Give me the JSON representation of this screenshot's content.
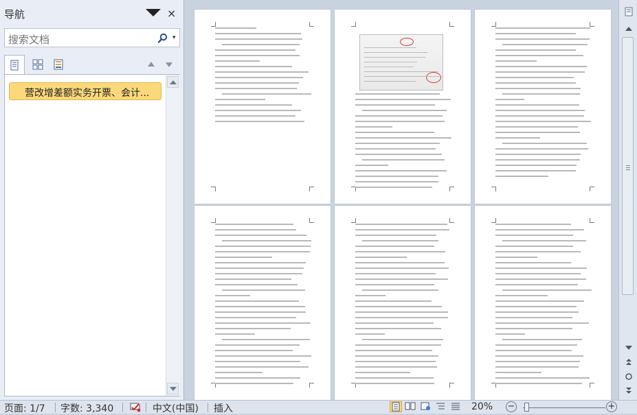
{
  "nav_pane": {
    "title": "导航",
    "close_glyph": "×",
    "search_placeholder": "搜索文档",
    "search_dropdown_glyph": "▾",
    "tabs": [
      "headings",
      "pages",
      "results"
    ],
    "headings": [
      "营改增差额实务开票、会计..."
    ]
  },
  "document": {
    "page_count_rendered": 6,
    "zoom": "20%"
  },
  "status_bar": {
    "page": "页面: 1/7",
    "words": "字数: 3,340",
    "language": "中文(中国)",
    "mode": "插入",
    "zoom": "20%",
    "zoom_minus": "−",
    "zoom_plus": "+"
  },
  "icons": {
    "search": "magnifier-icon",
    "tab_headings": "document-outline-icon",
    "tab_pages": "thumbnails-grid-icon",
    "tab_results": "list-results-icon",
    "spellcheck": "proofing-icon"
  },
  "colors": {
    "accent_highlight": "#fbd97a",
    "pane_bg": "#e9eef6",
    "doc_bg": "#c9d3e0"
  }
}
